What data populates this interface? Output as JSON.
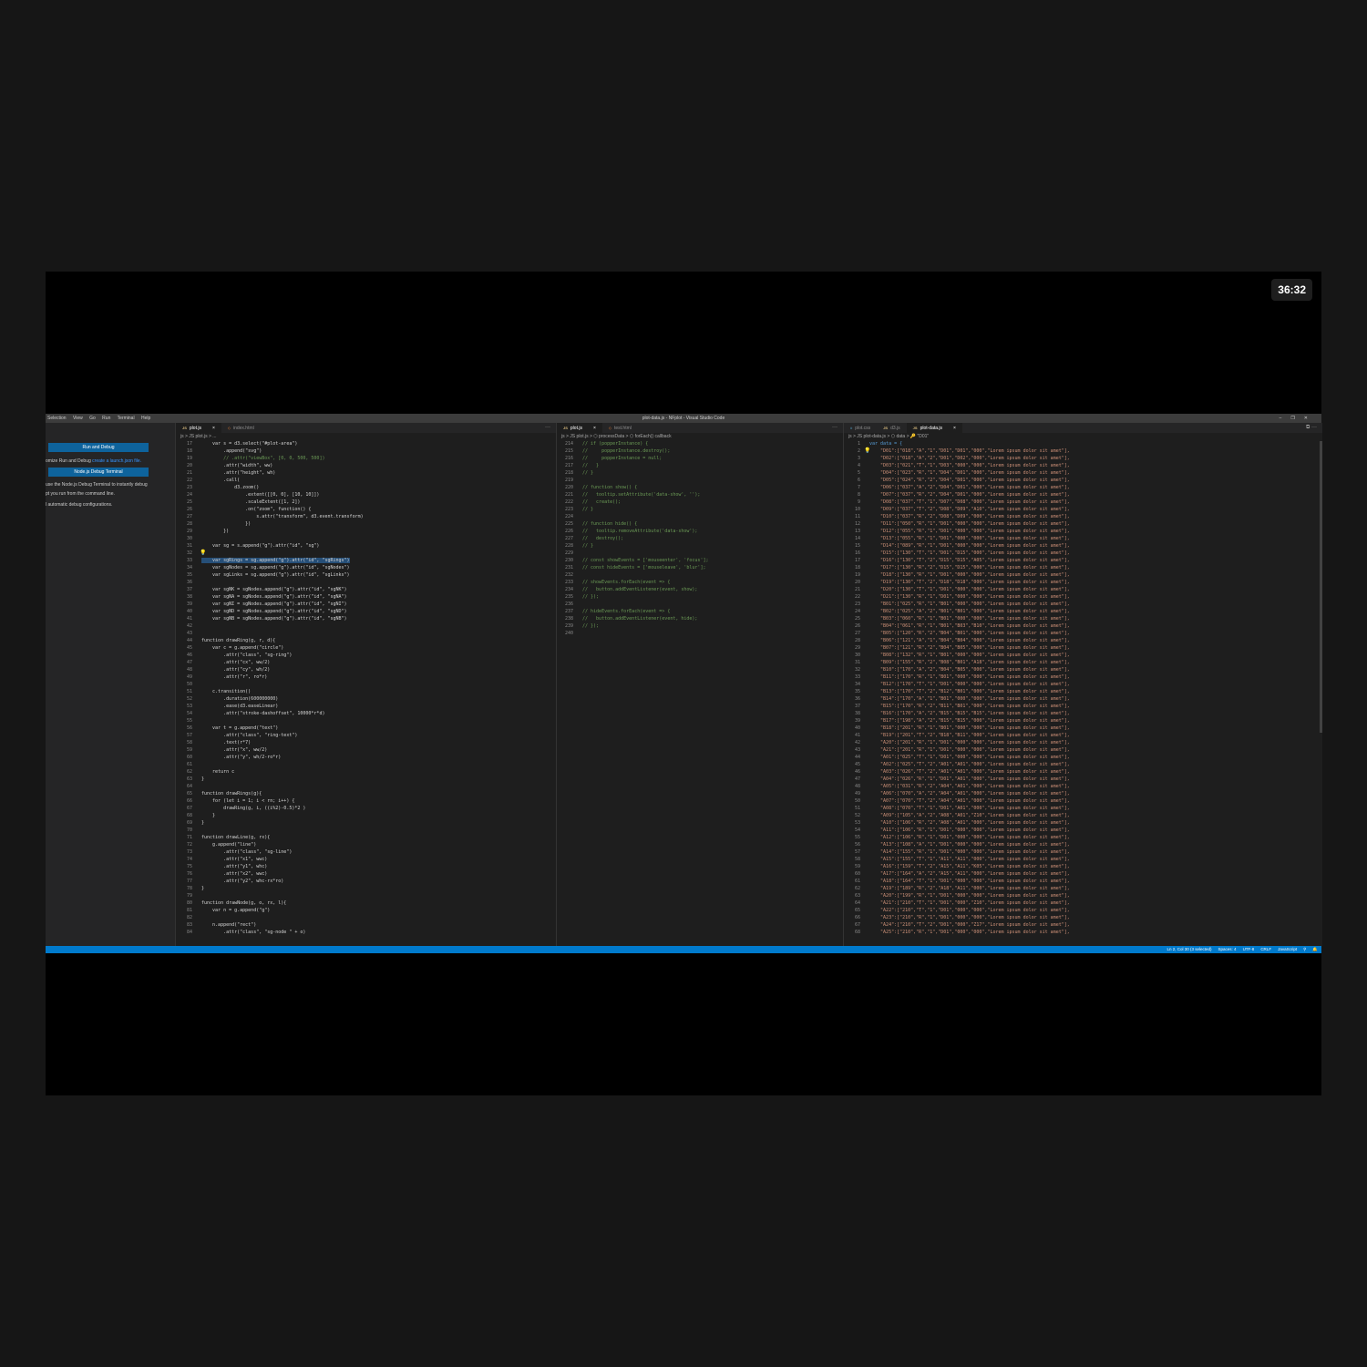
{
  "timer": "36:32",
  "window": {
    "title": "plot-data.js - NFplot - Visual Studio Code",
    "menus": [
      "Selection",
      "View",
      "Go",
      "Run",
      "Terminal",
      "Help"
    ],
    "controls": [
      "–",
      "❐",
      "✕"
    ]
  },
  "sidebar": {
    "run_debug_button": "Run and Debug",
    "text1_pre": "omize Run and Debug ",
    "text1_link": "create a launch.json file.",
    "node_terminal_button": "Node.js Debug Terminal",
    "text2": "use the Node.js Debug Terminal to instantly debug",
    "text3": "pt you run from the command line.",
    "text4": "l automatic debug configurations."
  },
  "pane1": {
    "tabs": [
      {
        "icon": "JS",
        "label": "plot.js",
        "close": "×",
        "active": true
      },
      {
        "icon": "◇",
        "label": "index.html",
        "close": "",
        "active": false
      }
    ],
    "actions": "···",
    "breadcrumb": "js > JS plot.js > ...",
    "lines": [
      {
        "n": "17",
        "t": "    var s = d3.select(\"#plot-area\")"
      },
      {
        "n": "18",
        "t": "        .append(\"svg\")"
      },
      {
        "n": "19",
        "t": "        // .attr(\"viewBox\", [0, 0, 500, 500])",
        "cm": true
      },
      {
        "n": "20",
        "t": "        .attr(\"width\", ww)"
      },
      {
        "n": "21",
        "t": "        .attr(\"height\", wh)"
      },
      {
        "n": "22",
        "t": "        .call("
      },
      {
        "n": "23",
        "t": "            d3.zoom()"
      },
      {
        "n": "24",
        "t": "                .extent([[0, 0], [10, 10]])"
      },
      {
        "n": "25",
        "t": "                .scaleExtent([1, 2])"
      },
      {
        "n": "26",
        "t": "                .on(\"zoom\", function() {"
      },
      {
        "n": "27",
        "t": "                    s.attr(\"transform\", d3.event.transform)"
      },
      {
        "n": "28",
        "t": "                })"
      },
      {
        "n": "29",
        "t": "        })"
      },
      {
        "n": "30",
        "t": ""
      },
      {
        "n": "31",
        "t": "    var sg = s.append(\"g\").attr(\"id\", \"sg\")"
      },
      {
        "n": "32",
        "t": "",
        "bulb": true
      },
      {
        "n": "33",
        "t": "    var sgRings = sg.append(\"g\").attr(\"id\", \"sgRings\")",
        "hl": true
      },
      {
        "n": "34",
        "t": "    var sgNodes = sg.append(\"g\").attr(\"id\", \"sgNodes\")"
      },
      {
        "n": "35",
        "t": "    var sgLinks = sg.append(\"g\").attr(\"id\", \"sgLinks\")"
      },
      {
        "n": "36",
        "t": ""
      },
      {
        "n": "37",
        "t": "    var sgNK = sgNodes.append(\"g\").attr(\"id\", \"sgNK\")"
      },
      {
        "n": "38",
        "t": "    var sgNA = sgNodes.append(\"g\").attr(\"id\", \"sgNA\")"
      },
      {
        "n": "39",
        "t": "    var sgNI = sgNodes.append(\"g\").attr(\"id\", \"sgNI\")"
      },
      {
        "n": "40",
        "t": "    var sgND = sgNodes.append(\"g\").attr(\"id\", \"sgND\")"
      },
      {
        "n": "41",
        "t": "    var sgNB = sgNodes.append(\"g\").attr(\"id\", \"sgNB\")"
      },
      {
        "n": "42",
        "t": ""
      },
      {
        "n": "43",
        "t": ""
      },
      {
        "n": "44",
        "t": "function drawRing(g, r, d){"
      },
      {
        "n": "45",
        "t": "    var c = g.append(\"circle\")"
      },
      {
        "n": "46",
        "t": "        .attr(\"class\", \"sg-ring\")"
      },
      {
        "n": "47",
        "t": "        .attr(\"cx\", ww/2)"
      },
      {
        "n": "48",
        "t": "        .attr(\"cy\", wh/2)"
      },
      {
        "n": "49",
        "t": "        .attr(\"r\", ro*r)"
      },
      {
        "n": "50",
        "t": ""
      },
      {
        "n": "51",
        "t": "    c.transition()"
      },
      {
        "n": "52",
        "t": "        .duration(600000000)"
      },
      {
        "n": "53",
        "t": "        .ease(d3.easeLinear)"
      },
      {
        "n": "54",
        "t": "        .attr(\"stroke-dashoffset\", 10000*r*d)"
      },
      {
        "n": "55",
        "t": ""
      },
      {
        "n": "56",
        "t": "    var t = g.append(\"text\")"
      },
      {
        "n": "57",
        "t": "        .attr(\"class\", \"ring-text\")"
      },
      {
        "n": "58",
        "t": "        .text(r*7)"
      },
      {
        "n": "59",
        "t": "        .attr(\"x\", ww/2)"
      },
      {
        "n": "60",
        "t": "        .attr(\"y\", wh/2-ro*r)"
      },
      {
        "n": "61",
        "t": ""
      },
      {
        "n": "62",
        "t": "    return c"
      },
      {
        "n": "63",
        "t": "}"
      },
      {
        "n": "64",
        "t": ""
      },
      {
        "n": "65",
        "t": "function drawRings(g){"
      },
      {
        "n": "66",
        "t": "    for (let i = 1; i < rn; i++) {"
      },
      {
        "n": "67",
        "t": "        drawRing(g, i, ((i%2)-0.5)*2 )"
      },
      {
        "n": "68",
        "t": "    }"
      },
      {
        "n": "69",
        "t": "}"
      },
      {
        "n": "70",
        "t": ""
      },
      {
        "n": "71",
        "t": "function drawLine(g, rx){"
      },
      {
        "n": "72",
        "t": "    g.append(\"line\")"
      },
      {
        "n": "73",
        "t": "        .attr(\"class\", \"sg-line\")"
      },
      {
        "n": "74",
        "t": "        .attr(\"x1\", wwc)"
      },
      {
        "n": "75",
        "t": "        .attr(\"y1\", whc)"
      },
      {
        "n": "76",
        "t": "        .attr(\"x2\", wwc)"
      },
      {
        "n": "77",
        "t": "        .attr(\"y2\", whc-rx*ro)"
      },
      {
        "n": "78",
        "t": "}"
      },
      {
        "n": "79",
        "t": ""
      },
      {
        "n": "80",
        "t": "function drawNode(g, o, rx, l){"
      },
      {
        "n": "81",
        "t": "    var n = g.append(\"g\")"
      },
      {
        "n": "82",
        "t": ""
      },
      {
        "n": "83",
        "t": "    n.append(\"rect\")"
      },
      {
        "n": "84",
        "t": "        .attr(\"class\", \"sg-node \" + o)"
      }
    ]
  },
  "pane2": {
    "tabs": [
      {
        "icon": "JS",
        "label": "plot.js",
        "close": "×",
        "active": true
      },
      {
        "icon": "◇",
        "label": "test.html",
        "close": "",
        "active": false
      }
    ],
    "actions": "···",
    "breadcrumb": "js > JS plot.js > ⬡ processData > ⬡ forEach() callback",
    "lines": [
      {
        "n": "214",
        "t": "// if (popperInstance) {",
        "cm": true
      },
      {
        "n": "215",
        "t": "//     popperInstance.destroy();",
        "cm": true
      },
      {
        "n": "216",
        "t": "//     popperInstance = null;",
        "cm": true
      },
      {
        "n": "217",
        "t": "//   }",
        "cm": true
      },
      {
        "n": "218",
        "t": "// }",
        "cm": true
      },
      {
        "n": "219",
        "t": ""
      },
      {
        "n": "220",
        "t": "// function show() {",
        "cm": true
      },
      {
        "n": "221",
        "t": "//   tooltip.setAttribute('data-show', '');",
        "cm": true
      },
      {
        "n": "222",
        "t": "//   create();",
        "cm": true
      },
      {
        "n": "223",
        "t": "// }",
        "cm": true
      },
      {
        "n": "224",
        "t": ""
      },
      {
        "n": "225",
        "t": "// function hide() {",
        "cm": true
      },
      {
        "n": "226",
        "t": "//   tooltip.removeAttribute('data-show');",
        "cm": true
      },
      {
        "n": "227",
        "t": "//   destroy();",
        "cm": true
      },
      {
        "n": "228",
        "t": "// }",
        "cm": true
      },
      {
        "n": "229",
        "t": ""
      },
      {
        "n": "230",
        "t": "// const showEvents = ['mouseenter', 'focus'];",
        "cm": true
      },
      {
        "n": "231",
        "t": "// const hideEvents = ['mouseleave', 'blur'];",
        "cm": true
      },
      {
        "n": "232",
        "t": ""
      },
      {
        "n": "233",
        "t": "// showEvents.forEach(event => {",
        "cm": true
      },
      {
        "n": "234",
        "t": "//   button.addEventListener(event, show);",
        "cm": true
      },
      {
        "n": "235",
        "t": "// });",
        "cm": true
      },
      {
        "n": "236",
        "t": ""
      },
      {
        "n": "237",
        "t": "// hideEvents.forEach(event => {",
        "cm": true
      },
      {
        "n": "238",
        "t": "//   button.addEventListener(event, hide);",
        "cm": true
      },
      {
        "n": "239",
        "t": "// });",
        "cm": true
      },
      {
        "n": "240",
        "t": ""
      }
    ]
  },
  "pane3": {
    "tabs": [
      {
        "icon": "#",
        "label": "plot.css",
        "close": "",
        "active": false
      },
      {
        "icon": "JS",
        "label": "d3.js",
        "close": "",
        "active": false
      },
      {
        "icon": "JS",
        "label": "plot-data.js",
        "close": "×",
        "active": true
      }
    ],
    "actions": "⧉ ···",
    "breadcrumb": "js > JS plot-data.js > ⬡ data > 🔑 \"D01\"",
    "lines": [
      {
        "n": "1",
        "t": "var data = {"
      },
      {
        "n": "2",
        "t": "    \"D01\":[\"018\",\"A\",\"1\",\"D01\",\"D01\",\"000\",\"Lorem ipsum dolor sit amet\"],",
        "bulb": true
      },
      {
        "n": "3",
        "t": "    \"D02\":[\"018\",\"A\",\"2\",\"D01\",\"D02\",\"000\",\"Lorem ipsum dolor sit amet\"],"
      },
      {
        "n": "4",
        "t": "    \"D03\":[\"021\",\"T\",\"1\",\"D03\",\"000\",\"000\",\"Lorem ipsum dolor sit amet\"],"
      },
      {
        "n": "5",
        "t": "    \"D04\":[\"023\",\"R\",\"1\",\"D04\",\"D01\",\"000\",\"Lorem ipsum dolor sit amet\"],"
      },
      {
        "n": "6",
        "t": "    \"D05\":[\"024\",\"R\",\"2\",\"D04\",\"D01\",\"000\",\"Lorem ipsum dolor sit amet\"],"
      },
      {
        "n": "7",
        "t": "    \"D06\":[\"037\",\"A\",\"2\",\"D04\",\"D01\",\"000\",\"Lorem ipsum dolor sit amet\"],"
      },
      {
        "n": "8",
        "t": "    \"D07\":[\"037\",\"R\",\"2\",\"D04\",\"D01\",\"000\",\"Lorem ipsum dolor sit amet\"],"
      },
      {
        "n": "9",
        "t": "    \"D08\":[\"037\",\"T\",\"1\",\"D07\",\"D08\",\"000\",\"Lorem ipsum dolor sit amet\"],"
      },
      {
        "n": "10",
        "t": "    \"D09\":[\"037\",\"T\",\"2\",\"D08\",\"D09\",\"A10\",\"Lorem ipsum dolor sit amet\"],"
      },
      {
        "n": "11",
        "t": "    \"D10\":[\"037\",\"R\",\"2\",\"D08\",\"D09\",\"000\",\"Lorem ipsum dolor sit amet\"],"
      },
      {
        "n": "12",
        "t": "    \"D11\":[\"050\",\"R\",\"1\",\"D01\",\"000\",\"000\",\"Lorem ipsum dolor sit amet\"],"
      },
      {
        "n": "13",
        "t": "    \"D12\":[\"055\",\"R\",\"1\",\"D01\",\"000\",\"000\",\"Lorem ipsum dolor sit amet\"],"
      },
      {
        "n": "14",
        "t": "    \"D13\":[\"055\",\"R\",\"1\",\"D01\",\"000\",\"000\",\"Lorem ipsum dolor sit amet\"],"
      },
      {
        "n": "15",
        "t": "    \"D14\":[\"089\",\"R\",\"1\",\"D01\",\"000\",\"000\",\"Lorem ipsum dolor sit amet\"],"
      },
      {
        "n": "16",
        "t": "    \"D15\":[\"130\",\"T\",\"1\",\"D01\",\"D15\",\"000\",\"Lorem ipsum dolor sit amet\"],"
      },
      {
        "n": "17",
        "t": "    \"D16\":[\"130\",\"T\",\"2\",\"D15\",\"D15\",\"A05\",\"Lorem ipsum dolor sit amet\"],"
      },
      {
        "n": "18",
        "t": "    \"D17\":[\"130\",\"R\",\"2\",\"D15\",\"D15\",\"000\",\"Lorem ipsum dolor sit amet\"],"
      },
      {
        "n": "19",
        "t": "    \"D18\":[\"130\",\"R\",\"1\",\"D01\",\"000\",\"000\",\"Lorem ipsum dolor sit amet\"],"
      },
      {
        "n": "20",
        "t": "    \"D19\":[\"130\",\"T\",\"2\",\"D18\",\"D18\",\"000\",\"Lorem ipsum dolor sit amet\"],"
      },
      {
        "n": "21",
        "t": "    \"D20\":[\"130\",\"T\",\"1\",\"D01\",\"000\",\"000\",\"Lorem ipsum dolor sit amet\"],"
      },
      {
        "n": "22",
        "t": "    \"D21\":[\"130\",\"R\",\"1\",\"D01\",\"000\",\"000\",\"Lorem ipsum dolor sit amet\"],"
      },
      {
        "n": "23",
        "t": "    \"B01\":[\"025\",\"R\",\"1\",\"B01\",\"000\",\"000\",\"Lorem ipsum dolor sit amet\"],"
      },
      {
        "n": "24",
        "t": "    \"B02\":[\"025\",\"A\",\"2\",\"B01\",\"B01\",\"000\",\"Lorem ipsum dolor sit amet\"],"
      },
      {
        "n": "25",
        "t": "    \"B03\":[\"060\",\"R\",\"1\",\"B01\",\"000\",\"000\",\"Lorem ipsum dolor sit amet\"],"
      },
      {
        "n": "26",
        "t": "    \"B04\":[\"061\",\"R\",\"1\",\"B01\",\"B03\",\"B10\",\"Lorem ipsum dolor sit amet\"],"
      },
      {
        "n": "27",
        "t": "    \"B05\":[\"120\",\"R\",\"2\",\"B04\",\"B01\",\"000\",\"Lorem ipsum dolor sit amet\"],"
      },
      {
        "n": "28",
        "t": "    \"B06\":[\"121\",\"A\",\"1\",\"B04\",\"B04\",\"000\",\"Lorem ipsum dolor sit amet\"],"
      },
      {
        "n": "29",
        "t": "    \"B07\":[\"121\",\"R\",\"2\",\"B04\",\"B05\",\"000\",\"Lorem ipsum dolor sit amet\"],"
      },
      {
        "n": "30",
        "t": "    \"B08\":[\"132\",\"R\",\"1\",\"B01\",\"000\",\"000\",\"Lorem ipsum dolor sit amet\"],"
      },
      {
        "n": "31",
        "t": "    \"B09\":[\"155\",\"R\",\"2\",\"B08\",\"B01\",\"A18\",\"Lorem ipsum dolor sit amet\"],"
      },
      {
        "n": "32",
        "t": "    \"B10\":[\"170\",\"A\",\"2\",\"B04\",\"B05\",\"000\",\"Lorem ipsum dolor sit amet\"],"
      },
      {
        "n": "33",
        "t": "    \"B11\":[\"170\",\"R\",\"1\",\"B01\",\"000\",\"000\",\"Lorem ipsum dolor sit amet\"],"
      },
      {
        "n": "34",
        "t": "    \"B12\":[\"170\",\"T\",\"1\",\"D01\",\"000\",\"000\",\"Lorem ipsum dolor sit amet\"],"
      },
      {
        "n": "35",
        "t": "    \"B13\":[\"170\",\"T\",\"2\",\"B12\",\"B01\",\"000\",\"Lorem ipsum dolor sit amet\"],"
      },
      {
        "n": "36",
        "t": "    \"B14\":[\"170\",\"A\",\"1\",\"B01\",\"000\",\"000\",\"Lorem ipsum dolor sit amet\"],"
      },
      {
        "n": "37",
        "t": "    \"B15\":[\"170\",\"R\",\"2\",\"B11\",\"B01\",\"000\",\"Lorem ipsum dolor sit amet\"],"
      },
      {
        "n": "38",
        "t": "    \"B16\":[\"170\",\"A\",\"2\",\"B15\",\"B15\",\"B15\",\"Lorem ipsum dolor sit amet\"],"
      },
      {
        "n": "39",
        "t": "    \"B17\":[\"198\",\"A\",\"2\",\"B15\",\"B15\",\"000\",\"Lorem ipsum dolor sit amet\"],"
      },
      {
        "n": "40",
        "t": "    \"B18\":[\"201\",\"R\",\"1\",\"B01\",\"000\",\"000\",\"Lorem ipsum dolor sit amet\"],"
      },
      {
        "n": "41",
        "t": "    \"B19\":[\"201\",\"T\",\"2\",\"B18\",\"B11\",\"000\",\"Lorem ipsum dolor sit amet\"],"
      },
      {
        "n": "42",
        "t": "    \"A20\":[\"201\",\"R\",\"1\",\"D01\",\"000\",\"000\",\"Lorem ipsum dolor sit amet\"],"
      },
      {
        "n": "43",
        "t": "    \"A21\":[\"201\",\"R\",\"1\",\"D01\",\"000\",\"000\",\"Lorem ipsum dolor sit amet\"],"
      },
      {
        "n": "44",
        "t": "    \"A01\":[\"025\",\"T\",\"1\",\"D01\",\"000\",\"000\",\"Lorem ipsum dolor sit amet\"],"
      },
      {
        "n": "45",
        "t": "    \"A02\":[\"025\",\"T\",\"2\",\"A01\",\"A01\",\"000\",\"Lorem ipsum dolor sit amet\"],"
      },
      {
        "n": "46",
        "t": "    \"A03\":[\"026\",\"T\",\"2\",\"A01\",\"A01\",\"000\",\"Lorem ipsum dolor sit amet\"],"
      },
      {
        "n": "47",
        "t": "    \"A04\":[\"026\",\"R\",\"1\",\"D01\",\"A01\",\"000\",\"Lorem ipsum dolor sit amet\"],"
      },
      {
        "n": "48",
        "t": "    \"A05\":[\"031\",\"R\",\"2\",\"A04\",\"A01\",\"000\",\"Lorem ipsum dolor sit amet\"],"
      },
      {
        "n": "49",
        "t": "    \"A06\":[\"070\",\"A\",\"2\",\"A04\",\"A01\",\"000\",\"Lorem ipsum dolor sit amet\"],"
      },
      {
        "n": "50",
        "t": "    \"A07\":[\"070\",\"T\",\"2\",\"A04\",\"A01\",\"000\",\"Lorem ipsum dolor sit amet\"],"
      },
      {
        "n": "51",
        "t": "    \"A08\":[\"070\",\"T\",\"1\",\"D01\",\"A01\",\"000\",\"Lorem ipsum dolor sit amet\"],"
      },
      {
        "n": "52",
        "t": "    \"A09\":[\"105\",\"A\",\"2\",\"A08\",\"A01\",\"Z10\",\"Lorem ipsum dolor sit amet\"],"
      },
      {
        "n": "53",
        "t": "    \"A10\":[\"106\",\"R\",\"2\",\"A08\",\"A01\",\"000\",\"Lorem ipsum dolor sit amet\"],"
      },
      {
        "n": "54",
        "t": "    \"A11\":[\"106\",\"R\",\"1\",\"D01\",\"000\",\"000\",\"Lorem ipsum dolor sit amet\"],"
      },
      {
        "n": "55",
        "t": "    \"A12\":[\"106\",\"R\",\"1\",\"D01\",\"000\",\"000\",\"Lorem ipsum dolor sit amet\"],"
      },
      {
        "n": "56",
        "t": "    \"A13\":[\"108\",\"A\",\"1\",\"D01\",\"000\",\"000\",\"Lorem ipsum dolor sit amet\"],"
      },
      {
        "n": "57",
        "t": "    \"A14\":[\"155\",\"R\",\"1\",\"D01\",\"000\",\"000\",\"Lorem ipsum dolor sit amet\"],"
      },
      {
        "n": "58",
        "t": "    \"A15\":[\"155\",\"T\",\"1\",\"A11\",\"A11\",\"000\",\"Lorem ipsum dolor sit amet\"],"
      },
      {
        "n": "59",
        "t": "    \"A16\":[\"159\",\"T\",\"2\",\"A15\",\"A11\",\"K05\",\"Lorem ipsum dolor sit amet\"],"
      },
      {
        "n": "60",
        "t": "    \"A17\":[\"164\",\"A\",\"2\",\"A15\",\"A11\",\"000\",\"Lorem ipsum dolor sit amet\"],"
      },
      {
        "n": "61",
        "t": "    \"A18\":[\"164\",\"T\",\"1\",\"D01\",\"000\",\"000\",\"Lorem ipsum dolor sit amet\"],"
      },
      {
        "n": "62",
        "t": "    \"A19\":[\"189\",\"R\",\"2\",\"A18\",\"A11\",\"000\",\"Lorem ipsum dolor sit amet\"],"
      },
      {
        "n": "63",
        "t": "    \"A20\":[\"199\",\"R\",\"1\",\"D01\",\"000\",\"000\",\"Lorem ipsum dolor sit amet\"],"
      },
      {
        "n": "64",
        "t": "    \"A21\":[\"210\",\"T\",\"1\",\"D01\",\"000\",\"Z10\",\"Lorem ipsum dolor sit amet\"],"
      },
      {
        "n": "65",
        "t": "    \"A22\":[\"210\",\"T\",\"1\",\"D01\",\"000\",\"000\",\"Lorem ipsum dolor sit amet\"],"
      },
      {
        "n": "66",
        "t": "    \"A23\":[\"210\",\"R\",\"1\",\"D01\",\"000\",\"000\",\"Lorem ipsum dolor sit amet\"],"
      },
      {
        "n": "67",
        "t": "    \"A24\":[\"210\",\"T\",\"2\",\"D01\",\"000\",\"Z17\",\"Lorem ipsum dolor sit amet\"],"
      },
      {
        "n": "68",
        "t": "    \"A25\":[\"210\",\"R\",\"1\",\"D01\",\"000\",\"000\",\"Lorem ipsum dolor sit amet\"],"
      }
    ]
  },
  "status": {
    "items": [
      "Ln 2, Col 30 (3 selected)",
      "Spaces: 4",
      "UTF-8",
      "CRLF",
      "JavaScript",
      "⚲",
      "🔔"
    ]
  }
}
